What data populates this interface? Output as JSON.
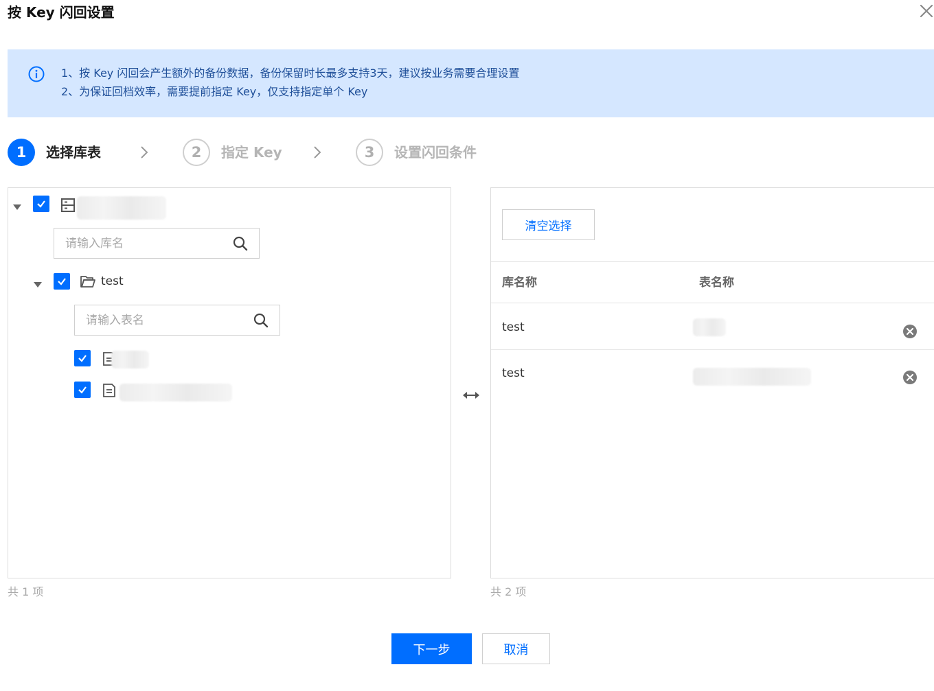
{
  "dialog": {
    "title": "按 Key 闪回设置"
  },
  "notice": {
    "line1": "1、按 Key 闪回会产生额外的备份数据，备份保留时长最多支持3天，建议按业务需要合理设置",
    "line2": "2、为保证回档效率，需要提前指定 Key，仅支持指定单个 Key"
  },
  "steps": [
    {
      "number": "1",
      "label": "选择库表"
    },
    {
      "number": "2",
      "label": "指定 Key"
    },
    {
      "number": "3",
      "label": "设置闪回条件"
    }
  ],
  "left_panel": {
    "db_search_placeholder": "请输入库名",
    "database": {
      "name": "test"
    },
    "table_search_placeholder": "请输入表名",
    "count_text": "共 1 项"
  },
  "right_panel": {
    "clear_button": "清空选择",
    "columns": {
      "db": "库名称",
      "table": "表名称"
    },
    "rows": [
      {
        "db": "test"
      },
      {
        "db": "test"
      }
    ],
    "count_text": "共 2 项"
  },
  "footer": {
    "next_button": "下一步",
    "cancel_button": "取消"
  },
  "colors": {
    "primary": "#006eff",
    "notice_bg": "#d5e7ff"
  }
}
